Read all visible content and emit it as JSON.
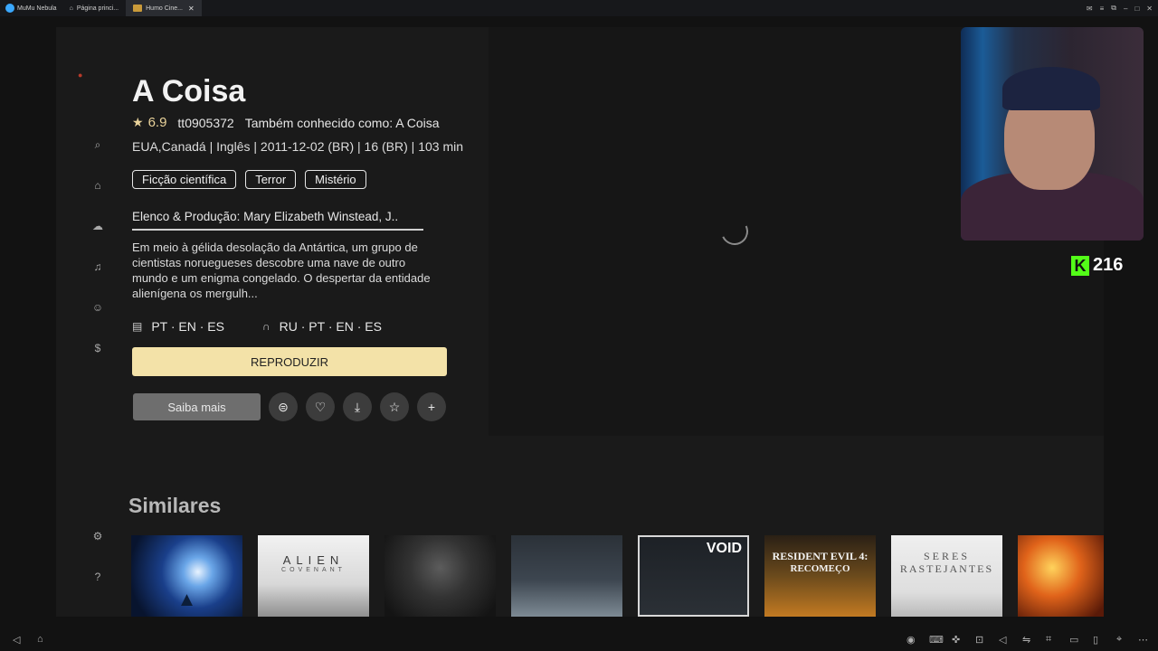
{
  "topbar": {
    "app_name": "MuMu Nebula",
    "tabs": [
      {
        "label": "Página princi..."
      },
      {
        "label": "Humo Cine..."
      }
    ]
  },
  "movie": {
    "title": "A Coisa",
    "rating": "6.9",
    "imdb_id": "tt0905372",
    "aka": "Também conhecido como: A Coisa",
    "info_line": "EUA,Canadá | Inglês | 2011-12-02 (BR) | 16 (BR) | 103 min",
    "genres": [
      "Ficção científica",
      "Terror",
      "Mistério"
    ],
    "cast": "Elenco & Produção: Mary Elizabeth Winstead, J..",
    "synopsis": "Em meio à gélida desolação da Antártica, um grupo de cientistas noruegueses descobre uma nave de outro mundo e um enigma congelado. O despertar da entidade alienígena os mergulh...",
    "subtitles": "PT · EN · ES",
    "audio": "RU · PT · EN · ES"
  },
  "actions": {
    "play_label": "REPRODUZIR",
    "more_label": "Saiba mais"
  },
  "similar": {
    "title": "Similares",
    "posters": [
      {
        "text": ""
      },
      {
        "text": "ALIEN",
        "subtext": "COVENANT"
      },
      {
        "text": ""
      },
      {
        "text": ""
      },
      {
        "text": "VOID"
      },
      {
        "text": "RESIDENT EVIL 4:",
        "subtext": "RECOMEÇO"
      },
      {
        "text": "SERES",
        "subtext": "RASTEJANTES"
      },
      {
        "text": ""
      }
    ]
  },
  "overlay": {
    "kick_count": "216"
  },
  "colors": {
    "play_button": "#f3e2a8",
    "rating_star": "#e9d29a",
    "kick_green": "#53fc18"
  }
}
